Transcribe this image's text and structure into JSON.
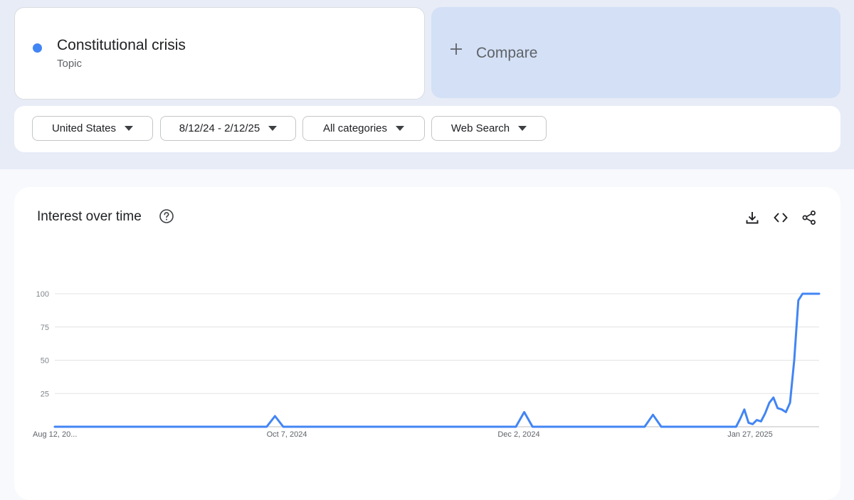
{
  "term": {
    "name": "Constitutional crisis",
    "type": "Topic",
    "color": "#4285f4"
  },
  "compare": {
    "label": "Compare"
  },
  "filters": [
    {
      "label": "United States"
    },
    {
      "label": "8/12/24 - 2/12/25"
    },
    {
      "label": "All categories"
    },
    {
      "label": "Web Search"
    }
  ],
  "chart_title": "Interest over time",
  "icons": {
    "help": "help-circle-icon",
    "download": "download-icon",
    "embed": "code-icon",
    "share": "share-icon"
  },
  "chart_data": {
    "type": "line",
    "title": "Interest over time",
    "xlabel": "",
    "ylabel": "",
    "ylim": [
      0,
      100
    ],
    "yticks": [
      25,
      50,
      75,
      100
    ],
    "xtick_labels": [
      "Aug 12, 20...",
      "Oct 7, 2024",
      "Dec 2, 2024",
      "Jan 27, 2025"
    ],
    "grid": true,
    "series": [
      {
        "color": "#4285f4",
        "x": [
          "2024-08-12",
          "2024-08-18",
          "2024-08-25",
          "2024-09-01",
          "2024-09-08",
          "2024-09-15",
          "2024-09-22",
          "2024-09-29",
          "2024-10-02",
          "2024-10-04",
          "2024-10-06",
          "2024-10-13",
          "2024-10-20",
          "2024-10-27",
          "2024-11-03",
          "2024-11-10",
          "2024-11-17",
          "2024-11-24",
          "2024-12-01",
          "2024-12-03",
          "2024-12-05",
          "2024-12-15",
          "2024-12-22",
          "2024-12-29",
          "2025-01-01",
          "2025-01-03",
          "2025-01-05",
          "2025-01-12",
          "2025-01-19",
          "2025-01-23",
          "2025-01-24",
          "2025-01-25",
          "2025-01-26",
          "2025-01-27",
          "2025-01-28",
          "2025-01-29",
          "2025-01-30",
          "2025-01-31",
          "2025-02-01",
          "2025-02-02",
          "2025-02-03",
          "2025-02-04",
          "2025-02-05",
          "2025-02-06",
          "2025-02-07",
          "2025-02-08",
          "2025-02-09",
          "2025-02-10",
          "2025-02-11",
          "2025-02-12"
        ],
        "y": [
          0,
          0,
          0,
          0,
          0,
          0,
          0,
          0,
          0,
          8,
          0,
          0,
          0,
          0,
          0,
          0,
          0,
          0,
          0,
          11,
          0,
          0,
          0,
          0,
          0,
          9,
          0,
          0,
          0,
          0,
          6,
          13,
          3,
          2,
          5,
          4,
          10,
          18,
          22,
          14,
          13,
          11,
          18,
          50,
          95,
          100,
          100,
          100,
          100,
          100
        ]
      }
    ]
  }
}
